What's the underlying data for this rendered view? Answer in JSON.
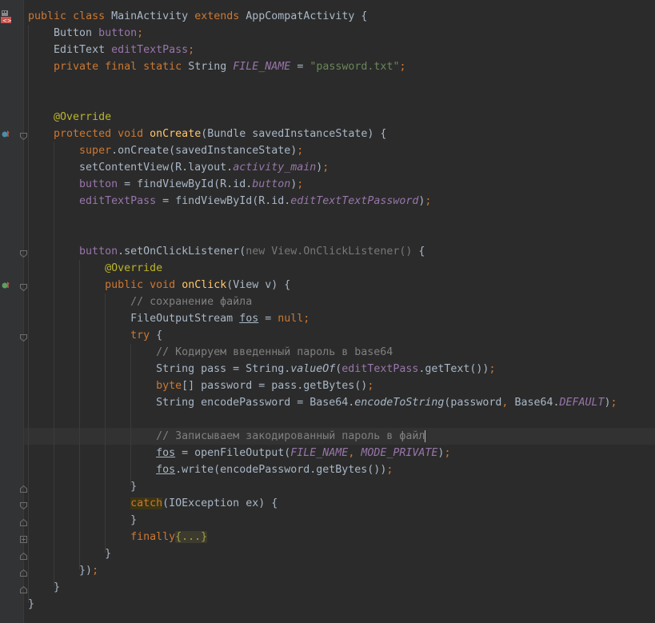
{
  "editor": {
    "lines": [
      [
        "public",
        "class",
        "MainActivity",
        "extends",
        "AppCompatActivity",
        "{"
      ],
      [
        "Button",
        "button",
        ";"
      ],
      [
        "EditText",
        "editTextPass",
        ";"
      ],
      [
        "private",
        "final",
        "static",
        "String",
        "FILE_NAME",
        "=",
        "\"password.txt\"",
        ";"
      ],
      [],
      [],
      [
        "@Override"
      ],
      [
        "protected",
        "void",
        "onCreate",
        "(Bundle savedInstanceState) {"
      ],
      [
        "super",
        ".onCreate(savedInstanceState)",
        ";"
      ],
      [
        "setContentView(R.layout.",
        "activity_main",
        ")",
        ";"
      ],
      [
        "button",
        " = findViewById(R.id.",
        "button",
        ")",
        ";"
      ],
      [
        "editTextPass",
        " = findViewById(R.id.",
        "editTextTextPassword",
        ")",
        ";"
      ],
      [],
      [],
      [
        "button",
        ".setOnClickListener(",
        "new View.OnClickListener()",
        " {"
      ],
      [
        "@Override"
      ],
      [
        "public",
        "void",
        "onClick",
        "(View v) {"
      ],
      [
        "// сохранение файла"
      ],
      [
        "FileOutputStream",
        "fos",
        " = ",
        "null",
        ";"
      ],
      [
        "try",
        " {"
      ],
      [
        "// Кодируем введенный пароль в base64"
      ],
      [
        "String pass = String.",
        "valueOf",
        "(",
        "editTextPass",
        ".getText())",
        ";"
      ],
      [
        "byte",
        "[] password = pass.getBytes()",
        ";"
      ],
      [
        "String encodePassword = Base64.",
        "encodeToString",
        "(password",
        ",",
        " Base64.",
        "DEFAULT",
        ")",
        ";"
      ],
      [],
      [
        "// Записываем закодированный пароль в файл"
      ],
      [
        "fos",
        " = openFileOutput(",
        "FILE_NAME",
        ",",
        "MODE_PRIVATE",
        ")",
        ";"
      ],
      [
        "fos",
        ".write(encodePassword.getBytes())",
        ";"
      ],
      [
        "}"
      ],
      [
        "catch",
        "(IOException ex) {"
      ],
      [
        "}"
      ],
      [
        "finally",
        "{...}"
      ],
      [
        "}"
      ],
      [
        "})",
        ";"
      ],
      [
        "}"
      ],
      [
        "}"
      ]
    ]
  },
  "colors": {
    "background": "#2b2b2b",
    "gutter": "#313335",
    "keyword": "#cc7832",
    "field": "#9876aa",
    "string": "#6a8759",
    "annotation": "#bbb529",
    "method_declaration": "#ffc66d",
    "comment": "#808080",
    "default_text": "#a9b7c6"
  },
  "icons": {
    "class_icon": "class-file-icon",
    "override_marker": "override-method-icon",
    "implement_marker": "implement-method-icon",
    "fold_marker": "fold-arrow-icon"
  }
}
